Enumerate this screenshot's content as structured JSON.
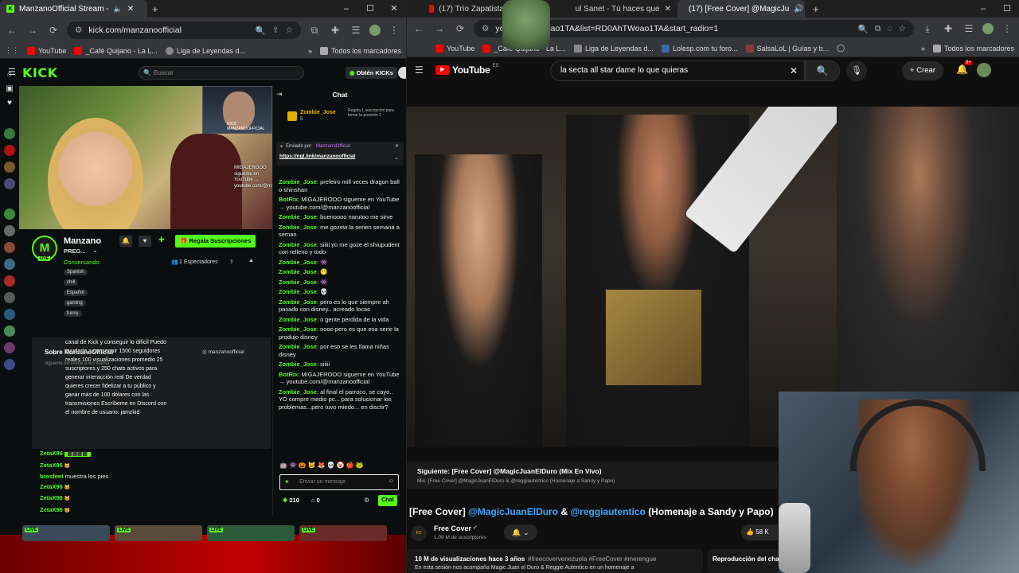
{
  "left_window": {
    "tab_title": "ManzanoOfficial Stream - ",
    "url": "kick.com/manzanoofficial",
    "bookmarks": [
      "YouTube",
      "_Café Quijano - La L...",
      "Liga de Leyendas d..."
    ],
    "bookmarks_folder": "Todos los marcadores",
    "kick": {
      "logo": "KICK",
      "search_placeholder": "Buscar",
      "get_kicks": "Obtén KICKs",
      "channel_name": "Manzano",
      "channel_sub": "PREG...",
      "category": "Conversando",
      "tags": [
        "Spanish",
        "chill",
        "Español",
        "gaming",
        "funny"
      ],
      "gift_subs": "Regala Suscripciones",
      "viewers": "1 Espectadores",
      "about_title": "Sobre ManzanoOfficial",
      "followers_note": "sigueme en sitime a wo mama",
      "instagram": "manzanoofficial",
      "promo_text": "canal de Kick y conseguir lo difícil Puedo ayudarte a conseguir 1500 seguidores reales 100 visualizaciones promedio 25 suscriptores y 250 chats activos para generar interacción real De verdad quieres crecer fidelizar a tu público y ganar más de 100 dólares con las transmisiones Escríbeme en Discord con el nombre de usuario: jamzkid",
      "overlay_text": "MIGAJEROOO sigueme en YouTube → youtube.com/@manzanoofficial",
      "cam_label": "KICK MANZANOOFFICIAL",
      "left_chat": [
        {
          "user": "ZetaX96",
          "msg": ""
        },
        {
          "user": "ZetaX96",
          "msg": ""
        },
        {
          "user": "brosfeet",
          "msg": "muestra los pies"
        },
        {
          "user": "ZetaX96",
          "msg": ""
        },
        {
          "user": "ZetaX96",
          "msg": ""
        },
        {
          "user": "ZetaX96",
          "msg": ""
        }
      ],
      "chat": {
        "header": "Chat",
        "pinned_user": "Zombie_Jose",
        "pinned_count": "5",
        "pinned_note": "Regala 1 suscripción para tomar la posición 2",
        "sent_by": "Enviado por",
        "sent_by_user": "ManzanoOfficial",
        "pinned_link": "https://ngl.link/manzanoofficial",
        "messages": [
          {
            "user": "Zombie_Jose",
            "msg": "prefeiro mill veces dragon ball o shinshan"
          },
          {
            "user": "BotRix",
            "msg": "MIGAJEROOO sigueme en YouTube → youtube.com/@manzanoofficial"
          },
          {
            "user": "Zombie_Jose",
            "msg": "buenoooo narutoo me sirve"
          },
          {
            "user": "Zombie_Jose",
            "msg": "me gozew la serien semana a seman"
          },
          {
            "user": "Zombie_Jose",
            "msg": "siiiii yo me goze el shiupudent con relleno y todo"
          },
          {
            "user": "Zombie_Jose",
            "msg": ""
          },
          {
            "user": "Zombie_Jose",
            "msg": ""
          },
          {
            "user": "Zombie_Jose",
            "msg": ""
          },
          {
            "user": "Zombie_Jose",
            "msg": ""
          },
          {
            "user": "Zombie_Jose",
            "msg": "pero es lo que siempre ah pasado con disney.. acreado locas"
          },
          {
            "user": "Zombie_Jose",
            "msg": "o gente perdida de la vida"
          },
          {
            "user": "Zombie_Jose",
            "msg": "nooo pero es que esa serie la produjo disney"
          },
          {
            "user": "Zombie_Jose",
            "msg": "por eso se les llama niñas disney"
          },
          {
            "user": "Zombie_Jose",
            "msg": "siiiii"
          },
          {
            "user": "BotRix",
            "msg": "MIGAJEROOO sigueme en YouTube → youtube.com/@manzanoofficial"
          },
          {
            "user": "Zombie_Jose",
            "msg": "al final el parroco, se cayo.. YO compre medio pc... para solucionar los problemas...pero tuvo miedo... en disctir?"
          }
        ],
        "input_placeholder": "Enviar un mensaje",
        "points": "210",
        "zero": "0",
        "send": "Chat"
      },
      "thumb_live": "LIVE"
    }
  },
  "right_window": {
    "tabs": [
      "(17) Trío Zapatista",
      "ul Sanet - Tú haces que",
      "(17) [Free Cover] @MagicJu"
    ],
    "url": "youtu...AhTWoao1TA&list=RD0AhTWoao1TA&start_radio=1",
    "bookmarks": [
      "YouTube",
      "_Café Quijano - La L...",
      "Liga de Leyendas d...",
      "Lolesp.com tu foro...",
      "SalsaLoL | Guías y b..."
    ],
    "bookmarks_folder": "Todos los marcadores",
    "yt": {
      "logo": "YouTube",
      "region": "ES",
      "search_value": "la secta all star dame lo que quieras",
      "create": "Crear",
      "notif": "9+",
      "next_label": "Siguiente: [Free Cover] @MagicJuanElDuro (Mix En Vivo)",
      "mix_label": "Mix: [Free Cover] @MagicJuanElDuro & @reggiautentico (Homenaje a Sandy y Papo)",
      "title_prefix": "[Free Cover]",
      "title_link1": "@MagicJuanElDuro",
      "title_amp": "&",
      "title_link2": "@reggiautentico",
      "title_suffix": "(Homenaje a Sandy y Papo)",
      "channel": "Free Cover",
      "subs": "1,09 M de suscriptores",
      "likes": "58 K",
      "views": "10 M de visualizaciones  hace 3 años",
      "hashtags": "#freecovervenezuela #FreeCover #merengue",
      "desc": "En esta sesión nos acompaña Magic Juan el Duro & Reggie Autentico en un homenaje a",
      "playlist": "Reproducción del chat"
    }
  }
}
